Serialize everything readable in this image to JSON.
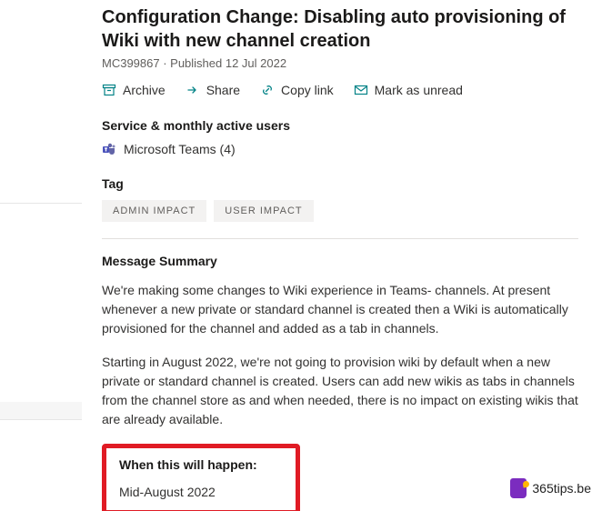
{
  "title": "Configuration Change: Disabling auto provisioning of Wiki with new channel creation",
  "meta": "MC399867 · Published 12 Jul 2022",
  "toolbar": {
    "archive": "Archive",
    "share": "Share",
    "copy": "Copy link",
    "unread": "Mark as unread"
  },
  "service": {
    "label": "Service & monthly active users",
    "product": "Microsoft Teams (4)"
  },
  "tag": {
    "label": "Tag",
    "items": [
      "ADMIN IMPACT",
      "USER IMPACT"
    ]
  },
  "summary": {
    "label": "Message Summary",
    "p1": "We're making some changes to Wiki experience in Teams- channels. At present whenever a new private or standard channel is created then a Wiki is automatically provisioned for the channel and added as a tab in channels.",
    "p2": "Starting in August 2022, we're not going to provision wiki by default when a new private or standard channel is created. Users can add new wikis as tabs in channels from the channel store as and when needed, there is no impact on existing wikis that are already available."
  },
  "highlight": {
    "heading": "When this will happen:",
    "value": "Mid-August 2022"
  },
  "watermark": "365tips.be"
}
